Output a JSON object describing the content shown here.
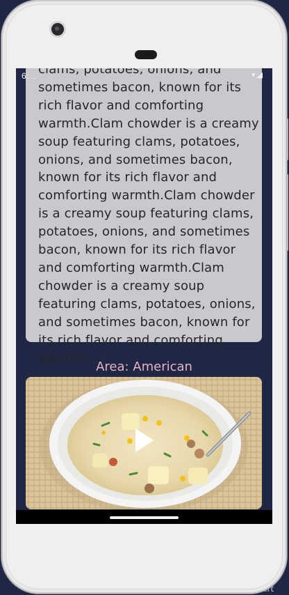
{
  "status_bar": {
    "time": "6:...",
    "icons": "▾◢"
  },
  "meal": {
    "description": "clams, potatoes, onions, and sometimes bacon, known for its rich flavor and comforting warmth.Clam chowder is a creamy soup featuring clams, potatoes, onions, and sometimes bacon, known for its rich flavor and comforting warmth.Clam chowder is a creamy soup featuring clams, potatoes, onions, and sometimes bacon, known for its rich flavor and comforting warmth.Clam chowder is a creamy soup featuring clams, potatoes, onions, and sometimes bacon, known for its rich flavor and comforting warmth.",
    "area_label": "Area: American",
    "video_thumbnail": "clam-chowder-bowl",
    "play_icon": "play-icon"
  },
  "background_label": "Dart",
  "colors": {
    "app_background": "#1f2745",
    "card_background": "#c8c9ce",
    "area_text": "#e3b3c6"
  }
}
